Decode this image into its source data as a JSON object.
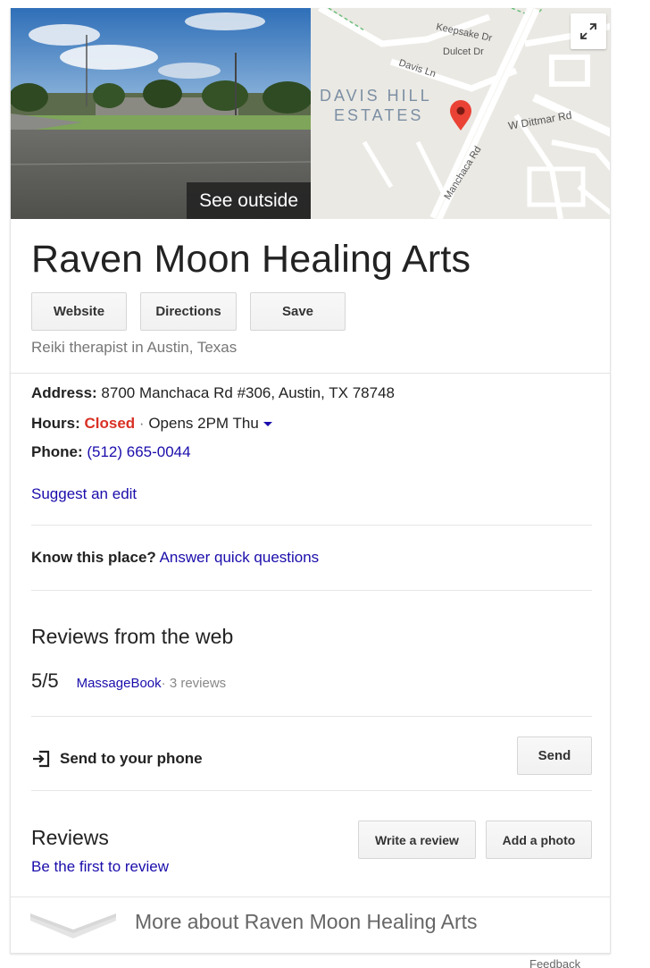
{
  "hero": {
    "see_outside_label": "See outside",
    "map_labels": {
      "keepsake": "Keepsake Dr",
      "dulcet": "Dulcet Dr",
      "davis_ln": "Davis Ln",
      "estates_line1": "DAVIS HILL",
      "estates_line2": "ESTATES",
      "dittmar": "W Dittmar Rd",
      "manchaca": "Manchaca Rd"
    },
    "expand_icon": "expand-icon",
    "pin_color": "#ea4335"
  },
  "business": {
    "name": "Raven Moon Healing Arts",
    "category": "Reiki therapist in Austin, Texas"
  },
  "actions": {
    "website": "Website",
    "directions": "Directions",
    "save": "Save"
  },
  "details": {
    "address_label": "Address:",
    "address_value": " 8700 Manchaca Rd #306, Austin, TX 78748",
    "hours_label": "Hours:",
    "hours_status": "Closed",
    "hours_sep": " · ",
    "hours_next": "Opens 2PM Thu",
    "phone_label": "Phone:",
    "phone_value": "(512) 665-0044",
    "suggest_edit": "Suggest an edit"
  },
  "know_place": {
    "label": "Know this place?",
    "link": "Answer quick questions"
  },
  "web_reviews": {
    "heading": "Reviews from the web",
    "score": "5/5",
    "source": "MassageBook",
    "count": " · 3 reviews"
  },
  "send_to_phone": {
    "label": "Send to your phone",
    "button": "Send",
    "icon": "send-to-device-icon"
  },
  "reviews": {
    "heading": "Reviews",
    "first_link": "Be the first to review",
    "write_button": "Write a review",
    "photo_button": "Add a photo"
  },
  "more": {
    "label": "More about Raven Moon Healing Arts",
    "icon": "chevron-down-icon"
  },
  "footer": {
    "feedback": "Feedback"
  },
  "colors": {
    "link": "#1a0dab",
    "closed": "#d93025",
    "text": "#222222",
    "muted": "#777777"
  }
}
